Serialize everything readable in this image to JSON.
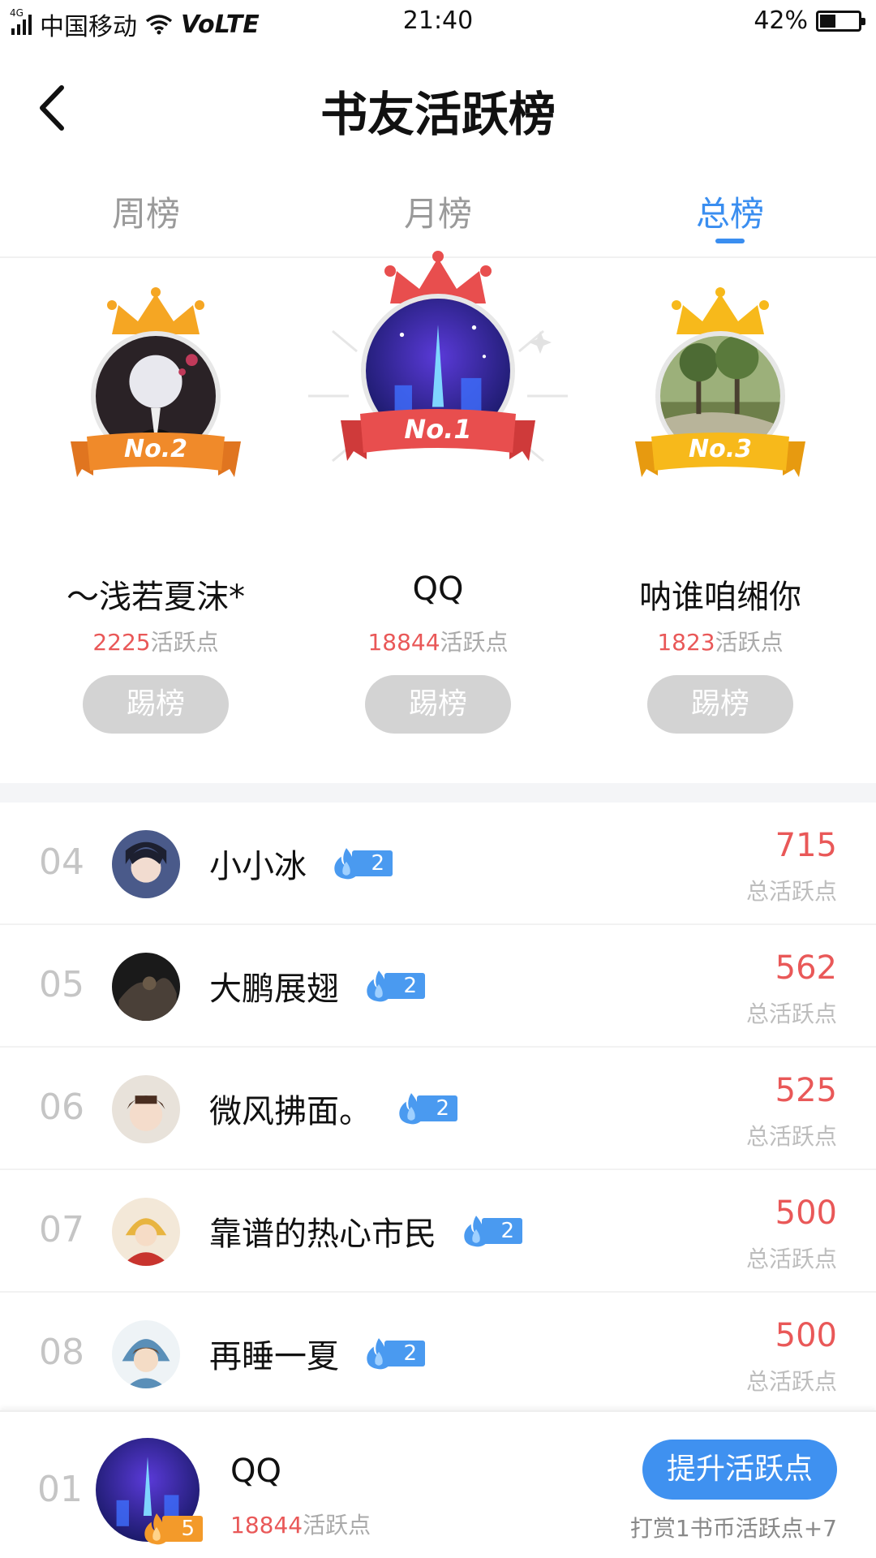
{
  "status": {
    "network": "4G",
    "carrier": "中国移动",
    "volte": "VoLTE",
    "time": "21:40",
    "battery_text": "42%",
    "battery_level": 0.42
  },
  "header": {
    "title": "书友活跃榜"
  },
  "tabs": [
    {
      "label": "周榜",
      "active": false
    },
    {
      "label": "月榜",
      "active": false
    },
    {
      "label": "总榜",
      "active": true
    }
  ],
  "podium": {
    "first": {
      "badge": "No.1",
      "name": "QQ",
      "score": "18844",
      "score_suffix": "活跃点",
      "button": "踢榜"
    },
    "second": {
      "badge": "No.2",
      "name": "～浅若夏沫*",
      "score": "2225",
      "score_suffix": "活跃点",
      "button": "踢榜"
    },
    "third": {
      "badge": "No.3",
      "name": "呐谁咱缃你",
      "score": "1823",
      "score_suffix": "活跃点",
      "button": "踢榜"
    }
  },
  "list": [
    {
      "rank": "04",
      "name": "小小冰",
      "level": "2",
      "score": "715",
      "score_label": "总活跃点"
    },
    {
      "rank": "05",
      "name": "大鹏展翅",
      "level": "2",
      "score": "562",
      "score_label": "总活跃点"
    },
    {
      "rank": "06",
      "name": "微风拂面。",
      "level": "2",
      "score": "525",
      "score_label": "总活跃点"
    },
    {
      "rank": "07",
      "name": "靠谱的热心市民",
      "level": "2",
      "score": "500",
      "score_label": "总活跃点"
    },
    {
      "rank": "08",
      "name": "再睡一夏",
      "level": "2",
      "score": "500",
      "score_label": "总活跃点"
    }
  ],
  "me": {
    "rank": "01",
    "name": "QQ",
    "level": "5",
    "score": "18844",
    "score_suffix": "活跃点",
    "boost_button": "提升活跃点",
    "tip": "打赏1书币活跃点+7"
  },
  "colors": {
    "accent": "#3a8ef0",
    "score_red": "#e95858",
    "gold": "#f5a623",
    "orange": "#f08a2a",
    "red": "#e84e4e"
  },
  "icons": [
    "back-arrow-icon",
    "crown-icon",
    "flame-icon",
    "wifi-icon",
    "signal-icon",
    "battery-icon"
  ]
}
